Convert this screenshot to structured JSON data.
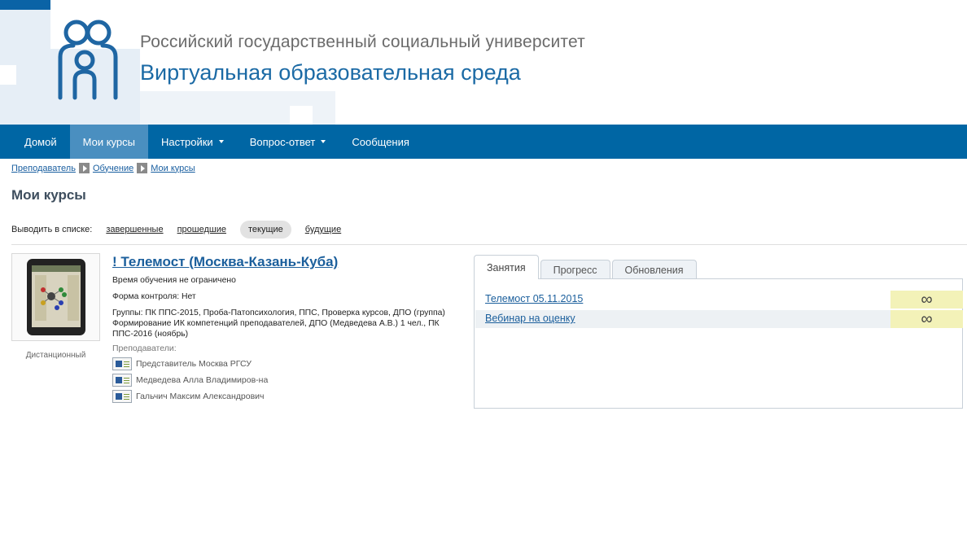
{
  "header": {
    "university": "Российский государственный социальный университет",
    "environment": "Виртуальная образовательная среда"
  },
  "nav": {
    "items": [
      {
        "label": "Домой"
      },
      {
        "label": "Мои курсы"
      },
      {
        "label": "Настройки"
      },
      {
        "label": "Вопрос-ответ"
      },
      {
        "label": "Сообщения"
      }
    ]
  },
  "breadcrumb": [
    "Преподаватель",
    "Обучение",
    "Мои курсы"
  ],
  "page": {
    "title": "Мои курсы"
  },
  "filter": {
    "label": "Выводить в списке:",
    "options": [
      "завершенные",
      "прошедшие",
      "текущие",
      "будущие"
    ]
  },
  "course": {
    "title": "! Телемост (Москва-Казань-Куба)",
    "thumb_caption": "Дистанционный",
    "time": "Время обучения не ограничено",
    "control": "Форма контроля: Нет",
    "groups": "Группы: ПК ППС-2015, Проба-Патопсихология, ППС, Проверка курсов, ДПО (группа) Формирование ИК компетенций преподавателей, ДПО (Медведева А.В.) 1 чел., ПК ППС-2016 (ноябрь)",
    "teachers_label": "Преподаватели:",
    "teachers": [
      "Представитель Москва РГСУ",
      "Медведева Алла Владимиров-на",
      "Гальчич Максим Александрович"
    ]
  },
  "tabs": [
    "Занятия",
    "Прогресс",
    "Обновления"
  ],
  "lessons": [
    {
      "title": "Телемост 05.11.2015",
      "score": "∞"
    },
    {
      "title": "Вебинар на оценку",
      "score": "∞"
    }
  ]
}
